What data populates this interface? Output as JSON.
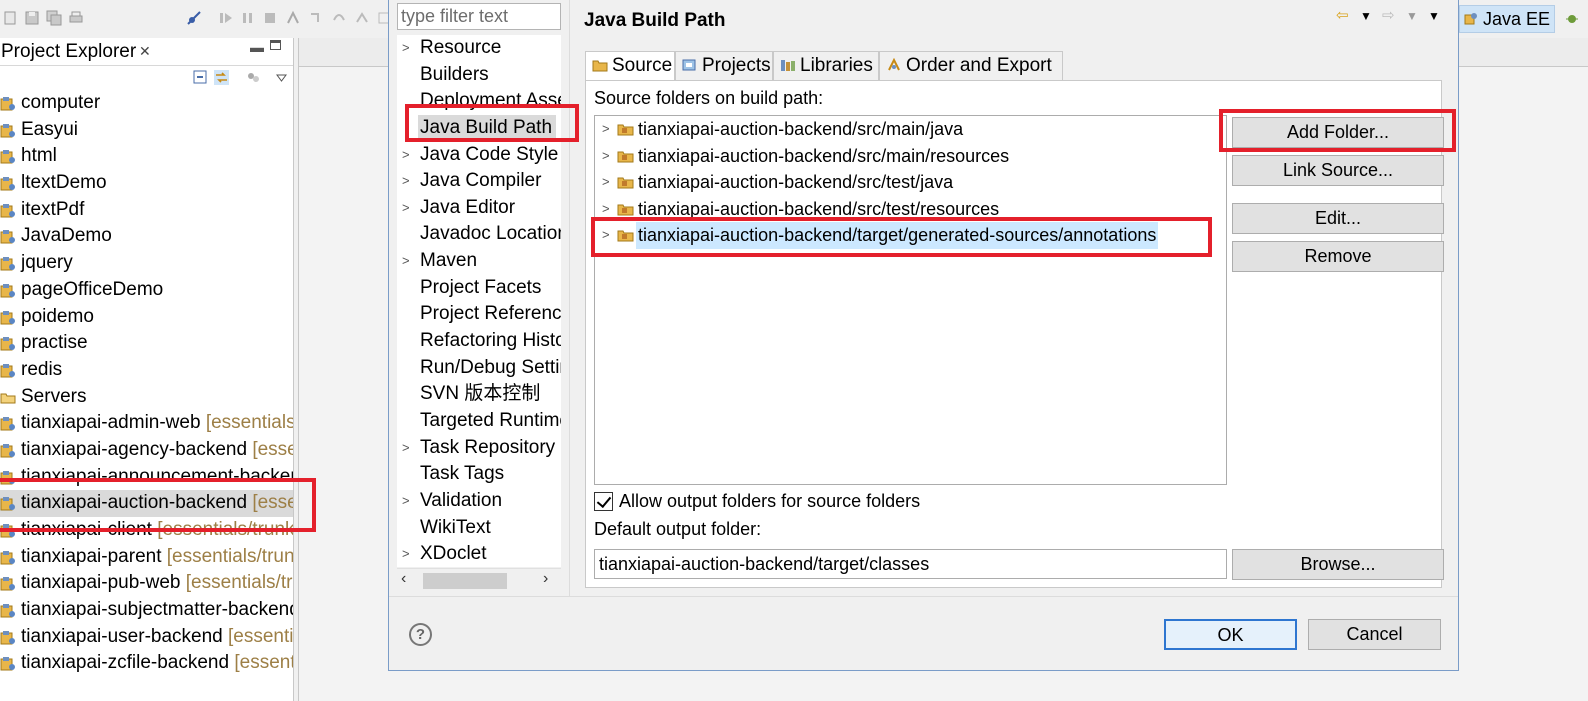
{
  "project_explorer": {
    "title": "Project Explorer",
    "projects": [
      {
        "name": "computer",
        "deco": ""
      },
      {
        "name": "Easyui",
        "deco": ""
      },
      {
        "name": "html",
        "deco": ""
      },
      {
        "name": "ltextDemo",
        "deco": ""
      },
      {
        "name": "itextPdf",
        "deco": ""
      },
      {
        "name": "JavaDemo",
        "deco": ""
      },
      {
        "name": "jquery",
        "deco": ""
      },
      {
        "name": "pageOfficeDemo",
        "deco": ""
      },
      {
        "name": "poidemo",
        "deco": ""
      },
      {
        "name": "practise",
        "deco": ""
      },
      {
        "name": "redis",
        "deco": ""
      },
      {
        "name": "Servers",
        "deco": ""
      },
      {
        "name": "tianxiapai-admin-web",
        "deco": "[essentials/"
      },
      {
        "name": "tianxiapai-agency-backend",
        "deco": "[essentials/"
      },
      {
        "name": "tianxiapai-announcement-backend",
        "deco": ""
      },
      {
        "name": "tianxiapai-auction-backend",
        "deco": "[essentials/"
      },
      {
        "name": "tianxiapai-client",
        "deco": "[essentials/trunk]"
      },
      {
        "name": "tianxiapai-parent",
        "deco": "[essentials/trunk]"
      },
      {
        "name": "tianxiapai-pub-web",
        "deco": "[essentials/trunk]"
      },
      {
        "name": "tianxiapai-subjectmatter-backend",
        "deco": ""
      },
      {
        "name": "tianxiapai-user-backend",
        "deco": "[essentials/"
      },
      {
        "name": "tianxiapai-zcfile-backend",
        "deco": "[essentials/"
      }
    ]
  },
  "dialog": {
    "filter_placeholder": "type filter text",
    "nav": [
      {
        "label": "Resource",
        "expandable": true
      },
      {
        "label": "Builders",
        "expandable": false
      },
      {
        "label": "Deployment Assembly",
        "expandable": false
      },
      {
        "label": "Java Build Path",
        "expandable": false
      },
      {
        "label": "Java Code Style",
        "expandable": true
      },
      {
        "label": "Java Compiler",
        "expandable": true
      },
      {
        "label": "Java Editor",
        "expandable": true
      },
      {
        "label": "Javadoc Location",
        "expandable": false
      },
      {
        "label": "Maven",
        "expandable": true
      },
      {
        "label": "Project Facets",
        "expandable": false
      },
      {
        "label": "Project References",
        "expandable": false
      },
      {
        "label": "Refactoring History",
        "expandable": false
      },
      {
        "label": "Run/Debug Settings",
        "expandable": false
      },
      {
        "label": "SVN 版本控制",
        "expandable": false
      },
      {
        "label": "Targeted Runtimes",
        "expandable": false
      },
      {
        "label": "Task Repository",
        "expandable": true
      },
      {
        "label": "Task Tags",
        "expandable": false
      },
      {
        "label": "Validation",
        "expandable": true
      },
      {
        "label": "WikiText",
        "expandable": false
      },
      {
        "label": "XDoclet",
        "expandable": true
      }
    ],
    "page_title": "Java Build Path",
    "tabs": [
      "Source",
      "Projects",
      "Libraries",
      "Order and Export"
    ],
    "source_folders_label": "Source folders on build path:",
    "source_folders": [
      "tianxiapai-auction-backend/src/main/java",
      "tianxiapai-auction-backend/src/main/resources",
      "tianxiapai-auction-backend/src/test/java",
      "tianxiapai-auction-backend/src/test/resources",
      "tianxiapai-auction-backend/target/generated-sources/annotations"
    ],
    "buttons": {
      "add_folder": "Add Folder...",
      "link_source": "Link Source...",
      "edit": "Edit...",
      "remove": "Remove",
      "browse": "Browse...",
      "ok": "OK",
      "cancel": "Cancel"
    },
    "allow_output_label": "Allow output folders for source folders",
    "allow_output_checked": true,
    "default_output_label": "Default output folder:",
    "default_output_value": "tianxiapai-auction-backend/target/classes",
    "help_glyph": "?"
  },
  "perspective": {
    "label": "Java EE"
  },
  "colors": {
    "annotation_red": "#e4202b",
    "selection": "#cce8ff",
    "ok_border": "#2e76d0"
  }
}
